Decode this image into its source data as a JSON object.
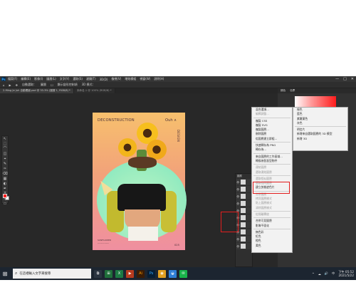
{
  "menubar": {
    "app": "Ps",
    "items": [
      "檔案(F)",
      "編輯(E)",
      "影像(I)",
      "圖層(L)",
      "文字(Y)",
      "選取(S)",
      "濾鏡(T)",
      "3D(D)",
      "檢視(V)",
      "增效模組",
      "視窗(W)",
      "說明(H)"
    ],
    "window_controls": [
      "—",
      "□",
      "✕"
    ]
  },
  "options_bar": {
    "items": [
      "⌂",
      "▶",
      "✥",
      "自動選取：",
      "圖層",
      "☐",
      "顯示變形控制項",
      "3D 模式："
    ]
  },
  "tabs": [
    {
      "label": "2-Ming Je Juh 自動獨創.psd @ 33.3% (圖層 1, RGB/8) *",
      "active": true
    },
    {
      "label": "未命名-1 @ 100% (RGB/8) *",
      "active": false
    }
  ],
  "tools": [
    "↖",
    "⬚",
    "⌒",
    "◫",
    "⌖",
    "✎",
    "✑",
    "⌫",
    "▦",
    "◐",
    "✒",
    "T",
    "↗",
    "▭",
    "✋",
    "🔍"
  ],
  "colors": {
    "foreground": "#ff1e1e",
    "background": "#ffffff",
    "highlight": "#e21e1e"
  },
  "document": {
    "title": "DECONSTRUCTION",
    "brand": "Ouh ∧",
    "vertical": "DESIGN",
    "footer_line1": "SUNFLOWER",
    "footer_line2": "---------------",
    "page_no": "025"
  },
  "context_menu": {
    "items": [
      {
        "label": "混合選項...",
        "disabled": false
      },
      {
        "label": "編輯調整...",
        "disabled": true
      },
      {
        "sep": true
      },
      {
        "label": "複製 CSS",
        "disabled": false
      },
      {
        "label": "複製 SVG",
        "disabled": false
      },
      {
        "label": "複製圖層...",
        "disabled": false
      },
      {
        "label": "刪除圖層",
        "disabled": false
      },
      {
        "label": "從圖層建立群組...",
        "disabled": false
      },
      {
        "sep": true
      },
      {
        "label": "快速轉存為 PNG",
        "disabled": false
      },
      {
        "label": "轉存為...",
        "disabled": false
      },
      {
        "sep": true
      },
      {
        "label": "來自圖層的工作區域...",
        "disabled": false
      },
      {
        "label": "轉換為智慧型物件",
        "disabled": false
      },
      {
        "sep": true
      },
      {
        "label": "連結圖層",
        "disabled": true
      },
      {
        "label": "選取連結圖層",
        "disabled": true
      },
      {
        "sep": true
      },
      {
        "label": "選取相似圖層",
        "disabled": true
      },
      {
        "label": "選取相同圖層",
        "disabled": true
      },
      {
        "label": "建立剪裁遮色片",
        "disabled": false
      },
      {
        "sep": true
      },
      {
        "label": "合併圖層",
        "disabled": true
      },
      {
        "label": "拷貝圖層樣式",
        "disabled": true
      },
      {
        "label": "貼上圖層樣式",
        "disabled": true
      },
      {
        "label": "清除圖層樣式",
        "disabled": true
      },
      {
        "sep": true
      },
      {
        "label": "從隔離釋放",
        "disabled": true
      },
      {
        "sep": true
      },
      {
        "label": "合併可見圖層",
        "disabled": false
      },
      {
        "label": "影像平面化",
        "disabled": false
      },
      {
        "sep": true
      },
      {
        "label": "無色彩",
        "disabled": false
      },
      {
        "label": "紅色",
        "disabled": false
      },
      {
        "label": "橙色",
        "disabled": false
      },
      {
        "label": "黃色",
        "disabled": false
      }
    ]
  },
  "submenu": {
    "items": [
      {
        "label": "綠色"
      },
      {
        "label": "藍色"
      },
      {
        "label": "紫羅蘭色"
      },
      {
        "label": "灰色"
      },
      {
        "sep": true
      },
      {
        "label": "明信片"
      },
      {
        "label": "新增來自選取圖層的 3D 模型"
      },
      {
        "label": "新增 3D"
      }
    ]
  },
  "right_panel": {
    "tabs": [
      "顏色",
      "色票"
    ]
  },
  "layers_panel": {
    "header": "圖層",
    "rows": [
      "👁",
      "👁",
      "👁",
      "👁",
      "👁",
      "👁",
      "👁",
      "👁",
      "👁",
      "👁"
    ]
  },
  "taskbar": {
    "search_placeholder": "在這裡輸入文字來搜尋",
    "apps": [
      "⧉",
      "⊞",
      "X",
      "▶",
      "Ai",
      "Ps",
      "◉",
      "◒",
      "✉"
    ],
    "tray": [
      "^",
      "☁",
      "🔊",
      "中"
    ],
    "time": "下午 05:52",
    "date": "2021/5/22"
  }
}
